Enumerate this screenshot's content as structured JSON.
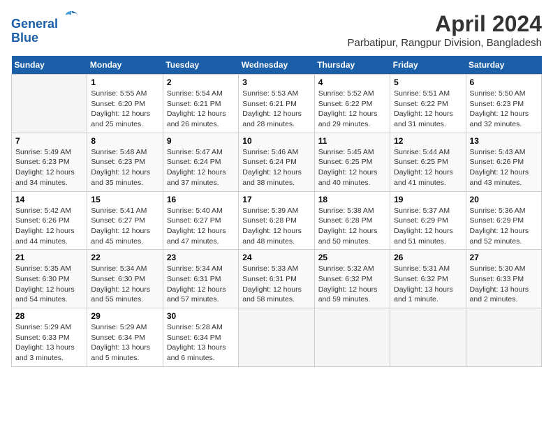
{
  "header": {
    "logo_line1": "General",
    "logo_line2": "Blue",
    "title": "April 2024",
    "subtitle": "Parbatipur, Rangpur Division, Bangladesh"
  },
  "calendar": {
    "weekdays": [
      "Sunday",
      "Monday",
      "Tuesday",
      "Wednesday",
      "Thursday",
      "Friday",
      "Saturday"
    ],
    "weeks": [
      [
        {
          "day": "",
          "info": ""
        },
        {
          "day": "1",
          "info": "Sunrise: 5:55 AM\nSunset: 6:20 PM\nDaylight: 12 hours\nand 25 minutes."
        },
        {
          "day": "2",
          "info": "Sunrise: 5:54 AM\nSunset: 6:21 PM\nDaylight: 12 hours\nand 26 minutes."
        },
        {
          "day": "3",
          "info": "Sunrise: 5:53 AM\nSunset: 6:21 PM\nDaylight: 12 hours\nand 28 minutes."
        },
        {
          "day": "4",
          "info": "Sunrise: 5:52 AM\nSunset: 6:22 PM\nDaylight: 12 hours\nand 29 minutes."
        },
        {
          "day": "5",
          "info": "Sunrise: 5:51 AM\nSunset: 6:22 PM\nDaylight: 12 hours\nand 31 minutes."
        },
        {
          "day": "6",
          "info": "Sunrise: 5:50 AM\nSunset: 6:23 PM\nDaylight: 12 hours\nand 32 minutes."
        }
      ],
      [
        {
          "day": "7",
          "info": "Sunrise: 5:49 AM\nSunset: 6:23 PM\nDaylight: 12 hours\nand 34 minutes."
        },
        {
          "day": "8",
          "info": "Sunrise: 5:48 AM\nSunset: 6:23 PM\nDaylight: 12 hours\nand 35 minutes."
        },
        {
          "day": "9",
          "info": "Sunrise: 5:47 AM\nSunset: 6:24 PM\nDaylight: 12 hours\nand 37 minutes."
        },
        {
          "day": "10",
          "info": "Sunrise: 5:46 AM\nSunset: 6:24 PM\nDaylight: 12 hours\nand 38 minutes."
        },
        {
          "day": "11",
          "info": "Sunrise: 5:45 AM\nSunset: 6:25 PM\nDaylight: 12 hours\nand 40 minutes."
        },
        {
          "day": "12",
          "info": "Sunrise: 5:44 AM\nSunset: 6:25 PM\nDaylight: 12 hours\nand 41 minutes."
        },
        {
          "day": "13",
          "info": "Sunrise: 5:43 AM\nSunset: 6:26 PM\nDaylight: 12 hours\nand 43 minutes."
        }
      ],
      [
        {
          "day": "14",
          "info": "Sunrise: 5:42 AM\nSunset: 6:26 PM\nDaylight: 12 hours\nand 44 minutes."
        },
        {
          "day": "15",
          "info": "Sunrise: 5:41 AM\nSunset: 6:27 PM\nDaylight: 12 hours\nand 45 minutes."
        },
        {
          "day": "16",
          "info": "Sunrise: 5:40 AM\nSunset: 6:27 PM\nDaylight: 12 hours\nand 47 minutes."
        },
        {
          "day": "17",
          "info": "Sunrise: 5:39 AM\nSunset: 6:28 PM\nDaylight: 12 hours\nand 48 minutes."
        },
        {
          "day": "18",
          "info": "Sunrise: 5:38 AM\nSunset: 6:28 PM\nDaylight: 12 hours\nand 50 minutes."
        },
        {
          "day": "19",
          "info": "Sunrise: 5:37 AM\nSunset: 6:29 PM\nDaylight: 12 hours\nand 51 minutes."
        },
        {
          "day": "20",
          "info": "Sunrise: 5:36 AM\nSunset: 6:29 PM\nDaylight: 12 hours\nand 52 minutes."
        }
      ],
      [
        {
          "day": "21",
          "info": "Sunrise: 5:35 AM\nSunset: 6:30 PM\nDaylight: 12 hours\nand 54 minutes."
        },
        {
          "day": "22",
          "info": "Sunrise: 5:34 AM\nSunset: 6:30 PM\nDaylight: 12 hours\nand 55 minutes."
        },
        {
          "day": "23",
          "info": "Sunrise: 5:34 AM\nSunset: 6:31 PM\nDaylight: 12 hours\nand 57 minutes."
        },
        {
          "day": "24",
          "info": "Sunrise: 5:33 AM\nSunset: 6:31 PM\nDaylight: 12 hours\nand 58 minutes."
        },
        {
          "day": "25",
          "info": "Sunrise: 5:32 AM\nSunset: 6:32 PM\nDaylight: 12 hours\nand 59 minutes."
        },
        {
          "day": "26",
          "info": "Sunrise: 5:31 AM\nSunset: 6:32 PM\nDaylight: 13 hours\nand 1 minute."
        },
        {
          "day": "27",
          "info": "Sunrise: 5:30 AM\nSunset: 6:33 PM\nDaylight: 13 hours\nand 2 minutes."
        }
      ],
      [
        {
          "day": "28",
          "info": "Sunrise: 5:29 AM\nSunset: 6:33 PM\nDaylight: 13 hours\nand 3 minutes."
        },
        {
          "day": "29",
          "info": "Sunrise: 5:29 AM\nSunset: 6:34 PM\nDaylight: 13 hours\nand 5 minutes."
        },
        {
          "day": "30",
          "info": "Sunrise: 5:28 AM\nSunset: 6:34 PM\nDaylight: 13 hours\nand 6 minutes."
        },
        {
          "day": "",
          "info": ""
        },
        {
          "day": "",
          "info": ""
        },
        {
          "day": "",
          "info": ""
        },
        {
          "day": "",
          "info": ""
        }
      ]
    ]
  }
}
